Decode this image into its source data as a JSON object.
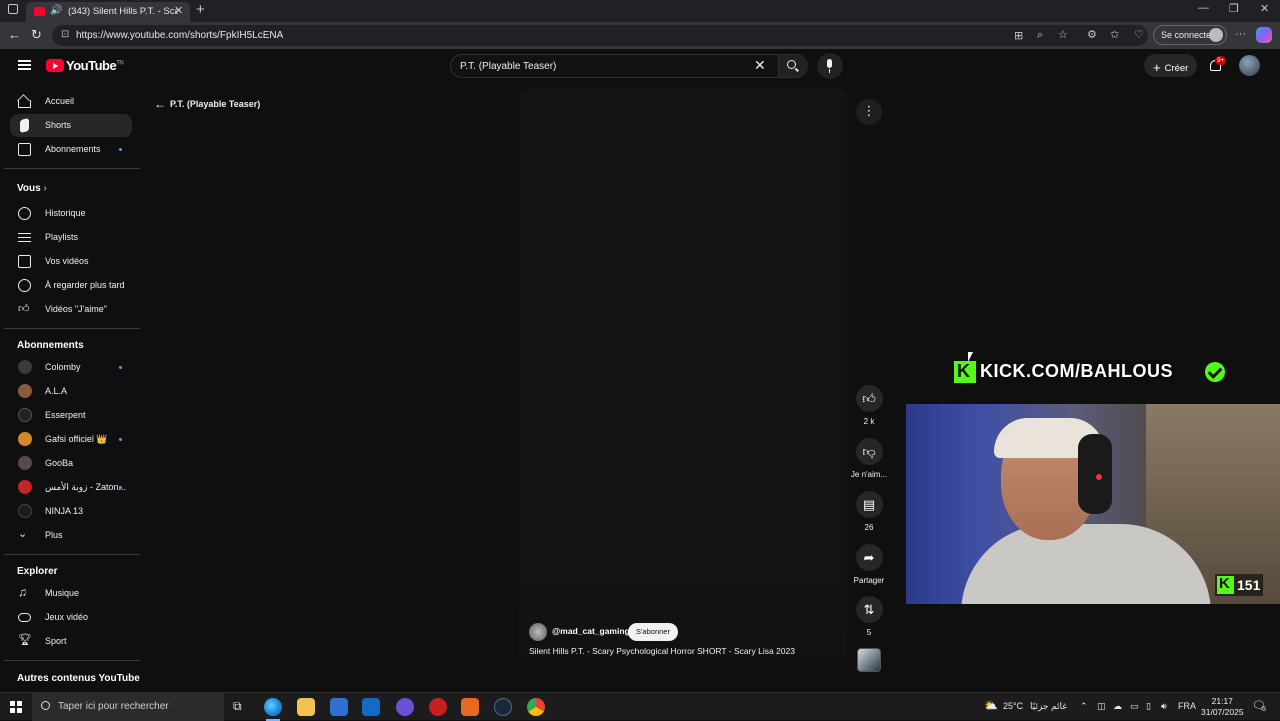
{
  "browser": {
    "tab_title": "(343) Silent Hills P.T. - Scary",
    "url": "https://www.youtube.com/shorts/FpkIH5LcENA",
    "sign_in_label": "Se connecter"
  },
  "youtube": {
    "logo_text": "YouTube",
    "logo_sup": "TN",
    "search_value": "P.T. (Playable Teaser)",
    "create_label": "Créer",
    "notif_badge": "9+"
  },
  "sidebar": {
    "main": [
      {
        "label": "Accueil",
        "icon": "home-icon"
      },
      {
        "label": "Shorts",
        "icon": "shorts-icon"
      },
      {
        "label": "Abonnements",
        "icon": "subscriptions-icon"
      }
    ],
    "you_header": "Vous",
    "you": [
      {
        "label": "Historique",
        "icon": "history-icon"
      },
      {
        "label": "Playlists",
        "icon": "playlists-icon"
      },
      {
        "label": "Vos vidéos",
        "icon": "your-videos-icon"
      },
      {
        "label": "À regarder plus tard",
        "icon": "watch-later-icon"
      },
      {
        "label": "Vidéos \"J'aime\"",
        "icon": "liked-videos-icon"
      }
    ],
    "subs_header": "Abonnements",
    "subs": [
      {
        "label": "Colomby",
        "color": "#3a3a3a"
      },
      {
        "label": "A.L.A",
        "color": "#8a5a3a"
      },
      {
        "label": "Esserpent",
        "color": "#222222"
      },
      {
        "label": "Gafsi officiel 👑",
        "color": "#d08a2a"
      },
      {
        "label": "GooBa",
        "color": "#5a4a4a"
      },
      {
        "label": "زوبة الأمس - Zaton...",
        "color": "#c0262a"
      },
      {
        "label": "NINJA 13",
        "color": "#1c1c1c"
      }
    ],
    "more_label": "Plus",
    "explore_header": "Explorer",
    "explore": [
      {
        "label": "Musique",
        "icon": "music-icon"
      },
      {
        "label": "Jeux vidéo",
        "icon": "gaming-icon"
      },
      {
        "label": "Sport",
        "icon": "sport-icon"
      }
    ],
    "other_header": "Autres contenus YouTube"
  },
  "short": {
    "back_label": "P.T. (Playable Teaser)",
    "channel": "@mad_cat_gaming",
    "subscribe_label": "S'abonner",
    "title": "Silent Hills P.T. - Scary Psychological Horror SHORT - Scary Lisa 2023",
    "likes": "2 k",
    "dislike_label": "Je n'aim...",
    "comments": "26",
    "share_label": "Partager",
    "remix": "5"
  },
  "overlay": {
    "kick_text": "KICK.COM/BAHLOUS",
    "viewers": "151",
    "kick_color": "#53fc18"
  },
  "taskbar": {
    "search_placeholder": "Taper ici pour rechercher",
    "temperature": "25°C",
    "weather_text": "غائم جزئيًا",
    "lang": "FRA",
    "time": "21:17",
    "date": "31/07/2025",
    "notif_count": "5"
  }
}
